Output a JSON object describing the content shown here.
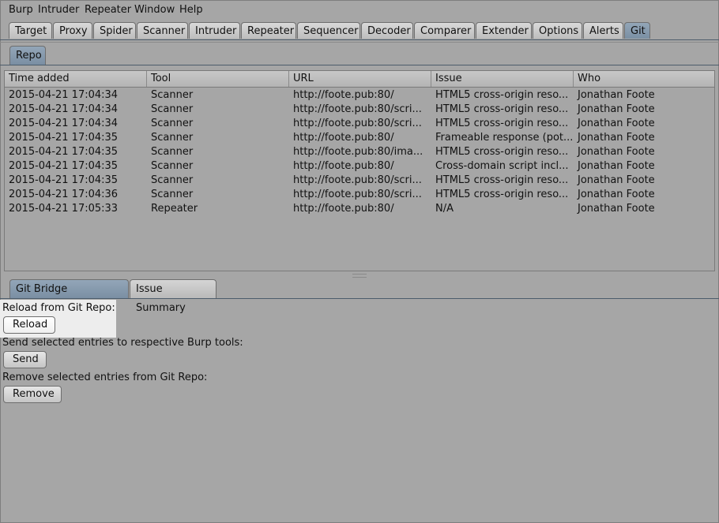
{
  "menu": [
    "Burp",
    "Intruder",
    "Repeater",
    "Window",
    "Help"
  ],
  "tabs": [
    "Target",
    "Proxy",
    "Spider",
    "Scanner",
    "Intruder",
    "Repeater",
    "Sequencer",
    "Decoder",
    "Comparer",
    "Extender",
    "Options",
    "Alerts",
    "Git"
  ],
  "active_tab": "Git",
  "subtab": "Repo",
  "table": {
    "columns": [
      "Time added",
      "Tool",
      "URL",
      "Issue",
      "Who"
    ],
    "rows": [
      [
        "2015-04-21 17:04:34",
        "Scanner",
        "http://foote.pub:80/",
        "HTML5 cross-origin reso...",
        "Jonathan Foote"
      ],
      [
        "2015-04-21 17:04:34",
        "Scanner",
        "http://foote.pub:80/scri...",
        "HTML5 cross-origin reso...",
        "Jonathan Foote"
      ],
      [
        "2015-04-21 17:04:34",
        "Scanner",
        "http://foote.pub:80/scri...",
        "HTML5 cross-origin reso...",
        "Jonathan Foote"
      ],
      [
        "2015-04-21 17:04:35",
        "Scanner",
        "http://foote.pub:80/",
        "Frameable response (pot...",
        "Jonathan Foote"
      ],
      [
        "2015-04-21 17:04:35",
        "Scanner",
        "http://foote.pub:80/ima...",
        "HTML5 cross-origin reso...",
        "Jonathan Foote"
      ],
      [
        "2015-04-21 17:04:35",
        "Scanner",
        "http://foote.pub:80/",
        "Cross-domain script incl...",
        "Jonathan Foote"
      ],
      [
        "2015-04-21 17:04:35",
        "Scanner",
        "http://foote.pub:80/scri...",
        "HTML5 cross-origin reso...",
        "Jonathan Foote"
      ],
      [
        "2015-04-21 17:04:36",
        "Scanner",
        "http://foote.pub:80/scri...",
        "HTML5 cross-origin reso...",
        "Jonathan Foote"
      ],
      [
        "2015-04-21 17:05:33",
        "Repeater",
        "http://foote.pub:80/",
        "N/A",
        "Jonathan Foote"
      ]
    ]
  },
  "bottom_tabs": [
    "Git Bridge Commands",
    "Issue Summary"
  ],
  "commands": {
    "reload_label": "Reload from Git Repo:",
    "reload_button": "Reload",
    "send_label": "Send selected entries to respective Burp tools:",
    "send_button": "Send",
    "remove_label": "Remove selected entries from Git Repo:",
    "remove_button": "Remove"
  },
  "colors": {
    "background": "#a6a6a6",
    "active_tab": "#869aae",
    "highlight": "#ededed"
  }
}
